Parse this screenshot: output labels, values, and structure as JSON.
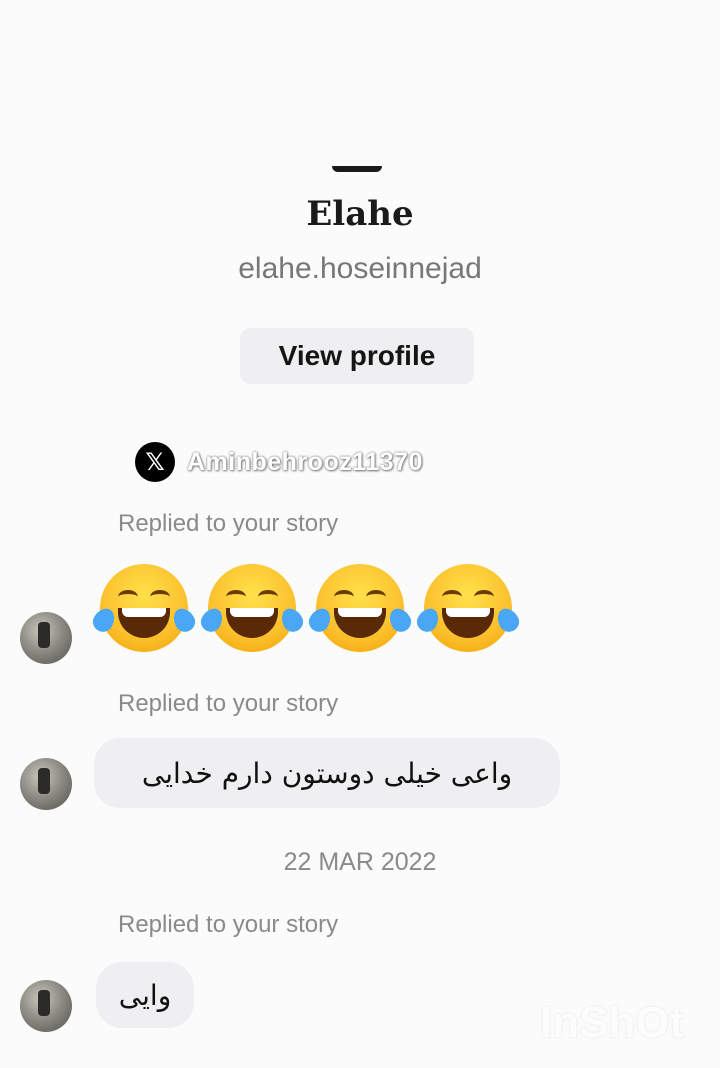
{
  "profile": {
    "name": "Elahe",
    "username": "elahe.hoseinnejad",
    "view_profile_label": "View profile"
  },
  "watermark": {
    "x_icon": "x-logo-icon",
    "text": "Aminbehrooz11370"
  },
  "messages": [
    {
      "replied_label": "Replied to your story",
      "type": "emoji",
      "emoji": "😂😂😂😂"
    },
    {
      "replied_label": "Replied to your story",
      "type": "text",
      "text": "واعی خیلی دوستون دارم خدایی"
    },
    {
      "replied_label": "Replied to your story",
      "type": "text",
      "text": "وایی"
    }
  ],
  "date_separator": "22 MAR 2022",
  "brand_watermark": "InShOt",
  "colors": {
    "background": "#fbfbfb",
    "bubble": "#efeff1",
    "muted_text": "#8a8a8a"
  }
}
